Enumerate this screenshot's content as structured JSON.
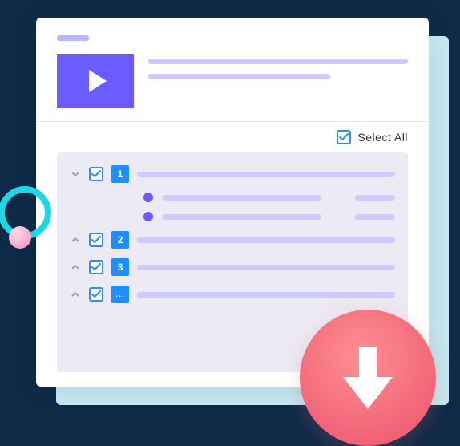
{
  "select_all_label": "Select All",
  "items": [
    {
      "num": "1",
      "expanded": true
    },
    {
      "num": "2",
      "expanded": false
    },
    {
      "num": "3",
      "expanded": false
    },
    {
      "num": "...",
      "expanded": false
    }
  ],
  "icons": {
    "play": "play-icon",
    "check": "check-icon",
    "caret_down": "chevron-down-icon",
    "caret_up": "chevron-up-icon",
    "download": "download-arrow-icon"
  },
  "colors": {
    "accent": "#6b5cff",
    "blue": "#1f8fff",
    "cyan": "#1cd8e6",
    "coral": "#ef5e74"
  }
}
